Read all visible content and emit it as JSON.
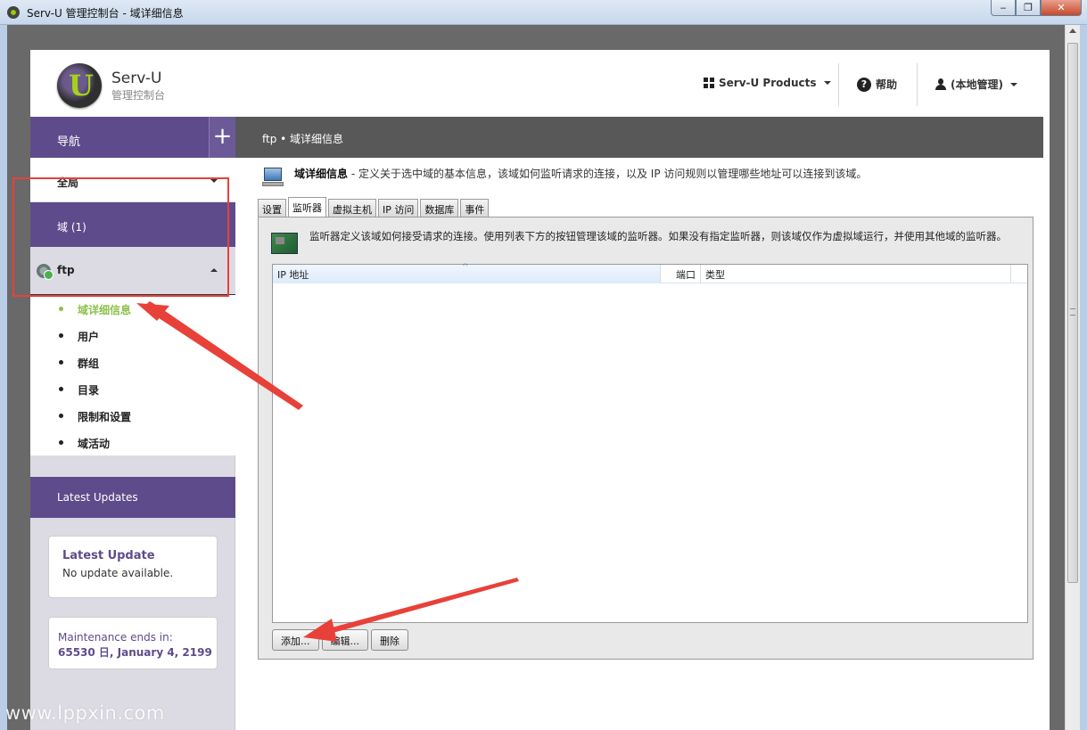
{
  "window": {
    "title": "Serv-U 管理控制台 - 域详细信息",
    "minimize": "‒",
    "restore": "❐",
    "close": "✕"
  },
  "header": {
    "brand_name": "Serv-U",
    "brand_sub": "管理控制台",
    "products_label": "Serv-U Products",
    "help_label": "帮助",
    "user_label": "(本地管理)"
  },
  "sidebar": {
    "nav_label": "导航",
    "global_label": "全局",
    "domain_label": "域 (1)",
    "ftp_label": "ftp",
    "sub_items": [
      {
        "label": "域详细信息",
        "active": true
      },
      {
        "label": "用户",
        "active": false
      },
      {
        "label": "群组",
        "active": false
      },
      {
        "label": "目录",
        "active": false
      },
      {
        "label": "限制和设置",
        "active": false
      },
      {
        "label": "域活动",
        "active": false
      }
    ],
    "updates_label": "Latest Updates",
    "latest_update": {
      "title": "Latest Update",
      "status": "No update available."
    },
    "maintenance": {
      "title": "Maintenance ends in:",
      "value": "65530 日, January 4, 2199"
    }
  },
  "content": {
    "breadcrumb": "ftp • 域详细信息",
    "info_title": "域详细信息",
    "info_desc": " - 定义关于选中域的基本信息，该域如何监听请求的连接，以及 IP 访问规则以管理哪些地址可以连接到该域。",
    "tabs": [
      "设置",
      "监听器",
      "虚拟主机",
      "IP 访问",
      "数据库",
      "事件"
    ],
    "active_tab": 1,
    "panel_desc": "监听器定义该域如何接受请求的连接。使用列表下方的按钮管理该域的监听器。如果没有指定监听器，则该域仅作为虚拟域运行，并使用其他域的监听器。",
    "columns": {
      "ip": "IP 地址",
      "port": "端口",
      "type": "类型"
    },
    "buttons": {
      "add": "添加...",
      "edit": "编辑...",
      "delete": "删除"
    }
  },
  "watermark": "www.lppxin.com",
  "colors": {
    "accent": "#5e4b8b",
    "active_item": "#8bc24a",
    "annotation": "#e8413a"
  }
}
